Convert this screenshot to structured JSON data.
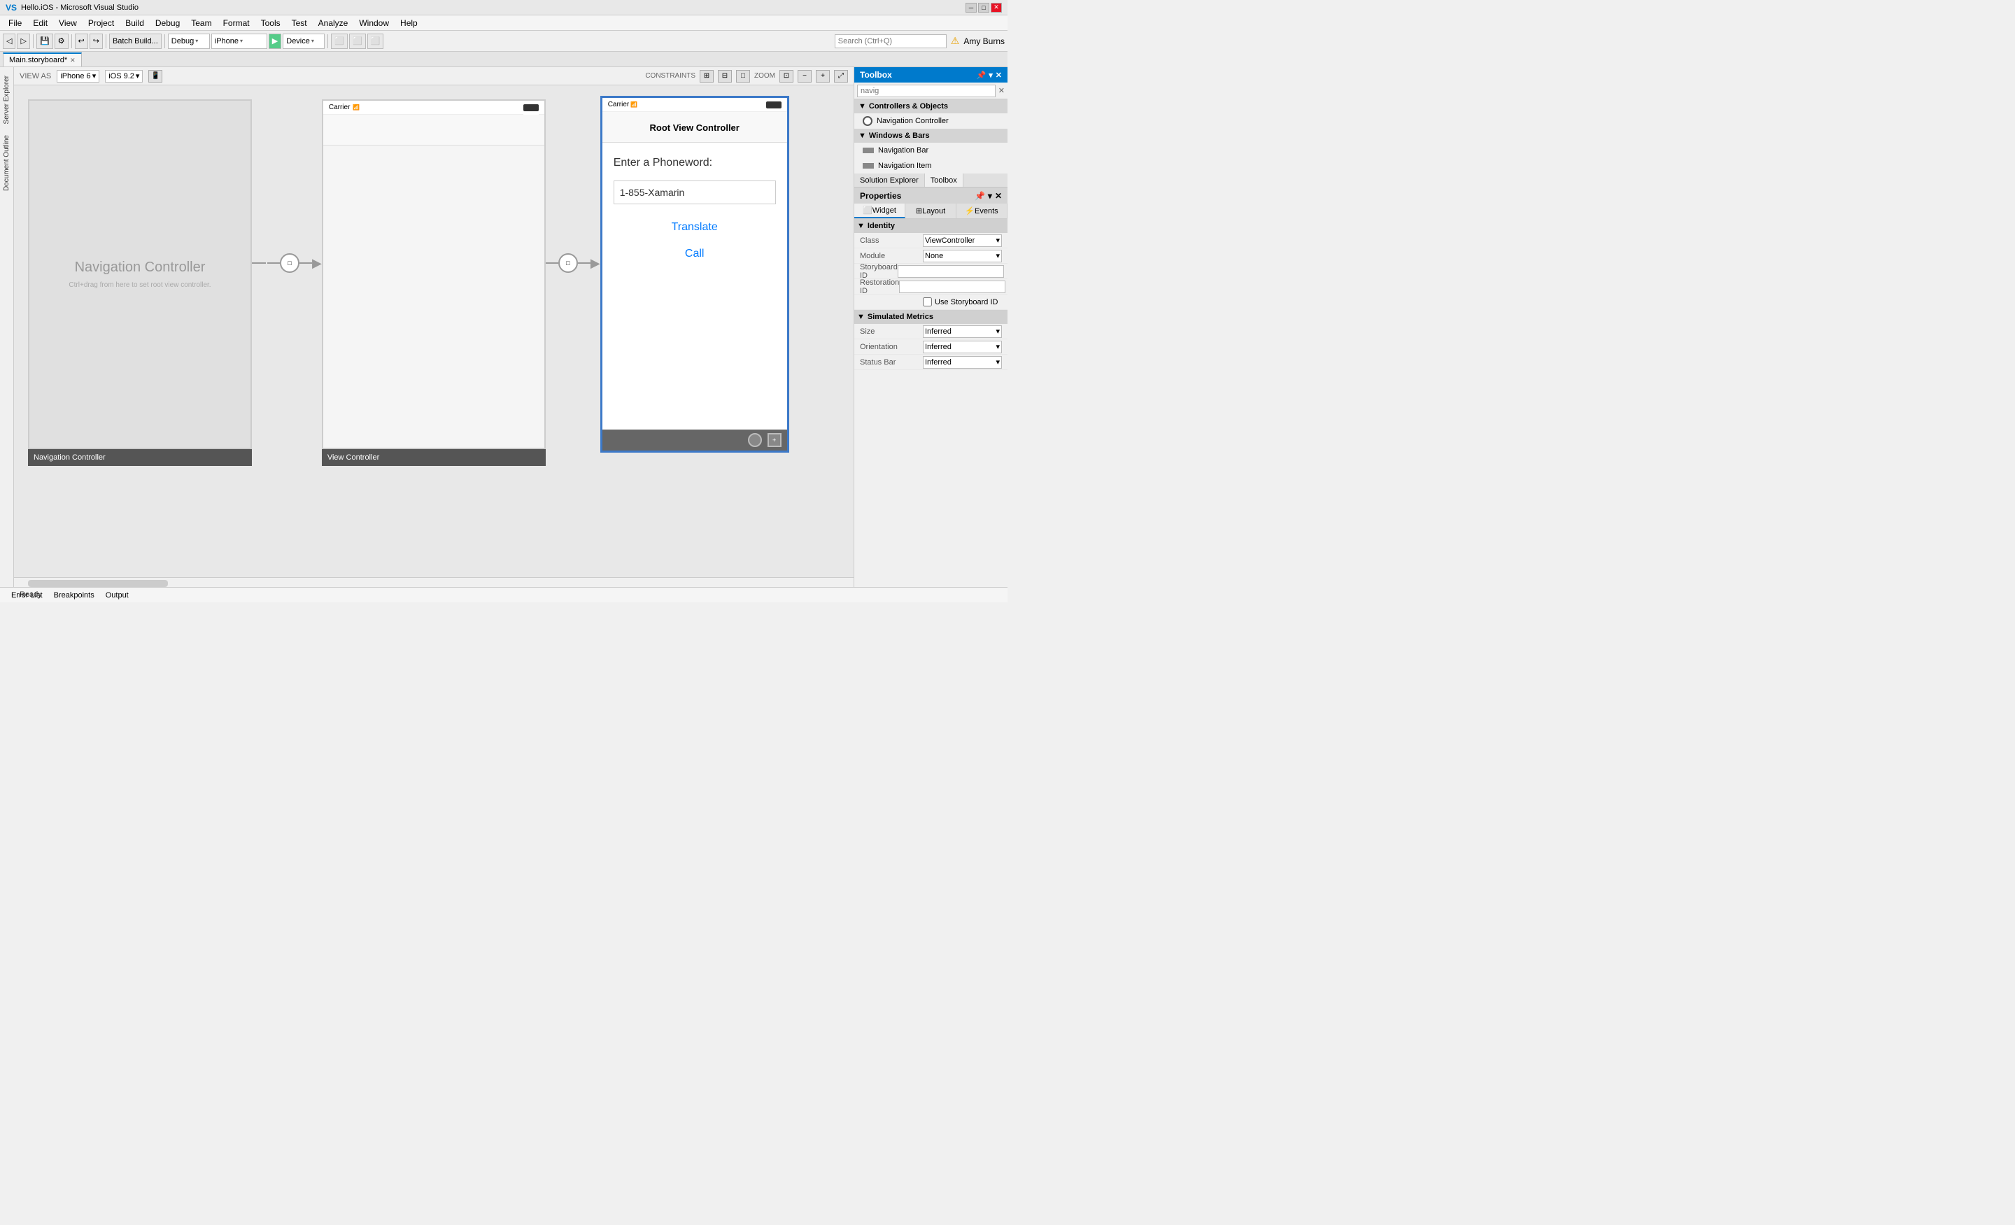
{
  "titlebar": {
    "title": "Hello.iOS - Microsoft Visual Studio",
    "icon": "VS"
  },
  "menubar": {
    "items": [
      "File",
      "Edit",
      "View",
      "Project",
      "Build",
      "Debug",
      "Team",
      "Format",
      "Tools",
      "Test",
      "Analyze",
      "Window",
      "Help"
    ]
  },
  "toolbar": {
    "batch_build": "Batch Build...",
    "debug_config": "Debug",
    "device": "iPhone",
    "device_arrow": "▾",
    "run_device": "Device",
    "user_warning": "⚠",
    "user_name": "Amy Burns"
  },
  "tabs": {
    "active_tab": "Main.storyboard*",
    "close_symbol": "✕"
  },
  "canvas": {
    "view_as_label": "VIEW AS",
    "iphone_model": "iPhone 6",
    "ios_version": "iOS 9.2",
    "constraints_label": "CONSTRAINTS",
    "zoom_label": "ZOOM"
  },
  "controllers": {
    "nav_controller": {
      "title": "Navigation Controller",
      "hint": "Ctrl+drag from here to set root view controller.",
      "label": "Navigation Controller"
    },
    "view_controller": {
      "label": "View Controller"
    },
    "root_vc": {
      "nav_title": "Root View Controller",
      "carrier": "Carrier",
      "phoneword_label": "Enter a Phoneword:",
      "phoneword_input": "1-855-Xamarin",
      "translate_btn": "Translate",
      "call_btn": "Call"
    }
  },
  "toolbox": {
    "title": "Toolbox",
    "search_placeholder": "navig",
    "sections": {
      "controllers_objects": "Controllers & Objects",
      "windows_bars": "Windows & Bars"
    },
    "items": {
      "nav_controller": "Navigation Controller",
      "nav_bar": "Navigation Bar",
      "nav_item": "Navigation Item"
    }
  },
  "sol_toolbox_tabs": {
    "solution_explorer": "Solution Explorer",
    "toolbox": "Toolbox"
  },
  "properties": {
    "title": "Properties",
    "tabs": {
      "widget": "Widget",
      "layout": "Layout",
      "events": "Events"
    },
    "identity": {
      "section": "Identity",
      "class_label": "Class",
      "class_value": "ViewController",
      "module_label": "Module",
      "module_value": "None",
      "storyboard_id_label": "Storyboard ID",
      "storyboard_id_value": "",
      "restoration_id_label": "Restoration ID",
      "restoration_id_value": "",
      "use_storyboard_id": "Use Storyboard ID"
    },
    "simulated_metrics": {
      "section": "Simulated Metrics",
      "size_label": "Size",
      "size_value": "Inferred",
      "orientation_label": "Orientation",
      "orientation_value": "Inferred",
      "status_bar_label": "Status Bar",
      "status_bar_value": "Inferred"
    }
  },
  "status_bar": {
    "tabs": [
      "Error List",
      "Breakpoints",
      "Output"
    ],
    "ready": "Ready"
  }
}
